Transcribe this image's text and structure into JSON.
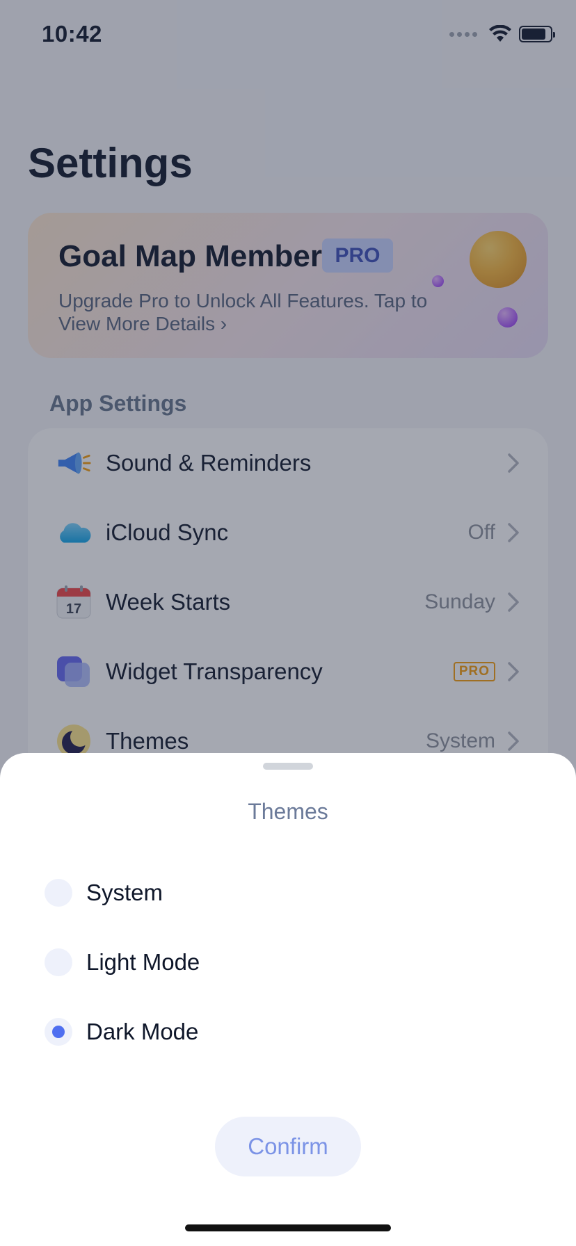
{
  "status_bar": {
    "time": "10:42"
  },
  "page_title": "Settings",
  "pro_card": {
    "title": "Goal Map Member",
    "badge": "PRO",
    "subtitle": "Upgrade Pro to Unlock All Features. Tap to View More Details ›"
  },
  "section_header": "App Settings",
  "settings": [
    {
      "label": "Sound & Reminders",
      "value": "",
      "icon": "megaphone-icon"
    },
    {
      "label": "iCloud Sync",
      "value": "Off",
      "icon": "cloud-icon"
    },
    {
      "label": "Week Starts",
      "value": "Sunday",
      "icon": "calendar-icon",
      "icon_text": "17"
    },
    {
      "label": "Widget Transparency",
      "badge": "PRO",
      "icon": "widget-icon"
    },
    {
      "label": "Themes",
      "value": "System",
      "icon": "moon-icon"
    }
  ],
  "sheet": {
    "title": "Themes",
    "options": [
      {
        "label": "System",
        "selected": false
      },
      {
        "label": "Light Mode",
        "selected": false
      },
      {
        "label": "Dark Mode",
        "selected": true
      }
    ],
    "confirm_label": "Confirm"
  },
  "colors": {
    "accent": "#4f6ff0",
    "pro_orange": "#f59e0b",
    "overlay": "#283046"
  }
}
